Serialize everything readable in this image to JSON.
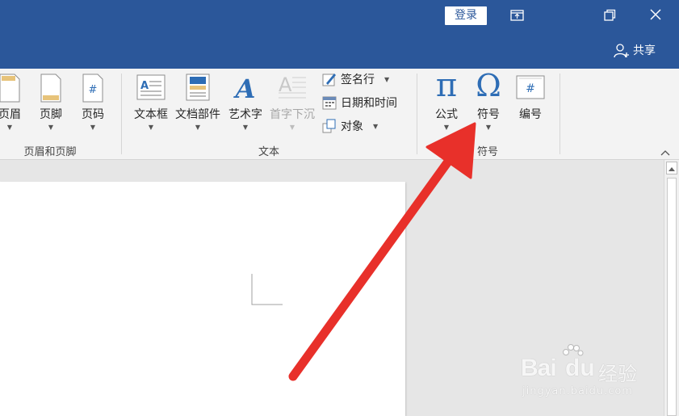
{
  "titlebar": {
    "login_label": "登录",
    "share_label": "共享"
  },
  "ribbon": {
    "header_footer": {
      "header_label": "页眉",
      "footer_label": "页脚",
      "page_number_label": "页码",
      "group_label": "页眉和页脚"
    },
    "text": {
      "textbox_label": "文本框",
      "quickparts_label": "文档部件",
      "wordart_label": "艺术字",
      "dropcap_label": "首字下沉",
      "signature_label": "签名行",
      "datetime_label": "日期和时间",
      "object_label": "对象",
      "group_label": "文本"
    },
    "symbols": {
      "equation_label": "公式",
      "symbol_label": "符号",
      "number_label": "编号",
      "group_label": "符号",
      "pi_glyph": "π",
      "omega_glyph": "Ω",
      "hash_glyph": "#",
      "wordart_glyph": "A"
    }
  },
  "watermark": {
    "brand": "Bai",
    "brand_paw": "du",
    "brand_cn": "经验",
    "url": "jingyan.baidu.com"
  },
  "colors": {
    "titlebar": "#2b579a",
    "accent_blue": "#2e6db5",
    "arrow_red": "#e8302a",
    "ribbon_bg": "#f3f3f3"
  }
}
